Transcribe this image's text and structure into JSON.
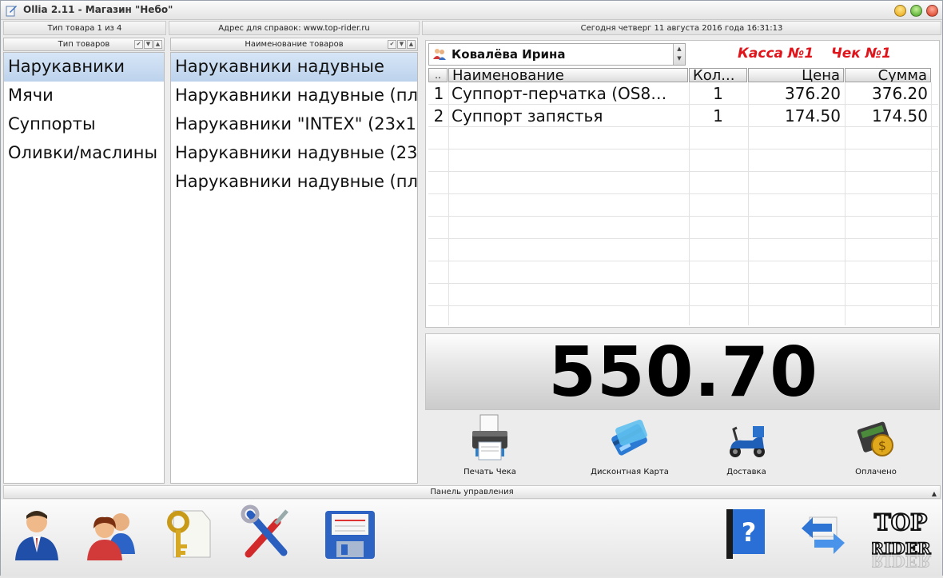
{
  "window": {
    "title": "Ollia 2.11 - Магазин \"Небо\""
  },
  "header": {
    "type_count": "Тип товара 1 из 4",
    "address": "Адрес для справок: www.top-rider.ru",
    "datetime": "Сегодня  четверг  11 августа 2016 года  16:31:13"
  },
  "types": {
    "header": "Тип товаров",
    "items": [
      "Нарукавники",
      "Мячи",
      "Суппорты",
      "Оливки/маслины"
    ]
  },
  "products": {
    "header": "Наименование товаров",
    "items": [
      "Нарукавники надувные",
      "Нарукавники надувные (пла",
      "Нарукавники \"INTEX\" (23x1",
      "Нарукавники надувные (23",
      "Нарукавники надувные (пла"
    ]
  },
  "receipt": {
    "cashier": "Ковалёва Ирина",
    "kassa": "Касса №1",
    "check": "Чек №1",
    "columns": [
      "..",
      "Наименование",
      "Кол...",
      "Цена",
      "Сумма"
    ],
    "rows": [
      {
        "n": "1",
        "name": "Суппорт-перчатка (OS8…",
        "qty": "1",
        "price": "376.20",
        "sum": "376.20"
      },
      {
        "n": "2",
        "name": "Суппорт запястья",
        "qty": "1",
        "price": "174.50",
        "sum": "174.50"
      }
    ],
    "total": "550.70"
  },
  "actions": [
    {
      "label": "Печать Чека",
      "icon": "printer-icon"
    },
    {
      "label": "Дисконтная Карта",
      "icon": "discount-card-icon"
    },
    {
      "label": "Доставка",
      "icon": "scooter-icon"
    },
    {
      "label": "Оплачено",
      "icon": "paid-wallet-icon"
    }
  ],
  "panel": {
    "title": "Панель управления"
  },
  "toolbar": {
    "icons": [
      "user-icon",
      "users-icon",
      "key-icon",
      "tools-icon",
      "save-icon",
      "help-book-icon",
      "sync-icon",
      "top-rider-logo"
    ],
    "logo_text": "TOP RIDER"
  }
}
